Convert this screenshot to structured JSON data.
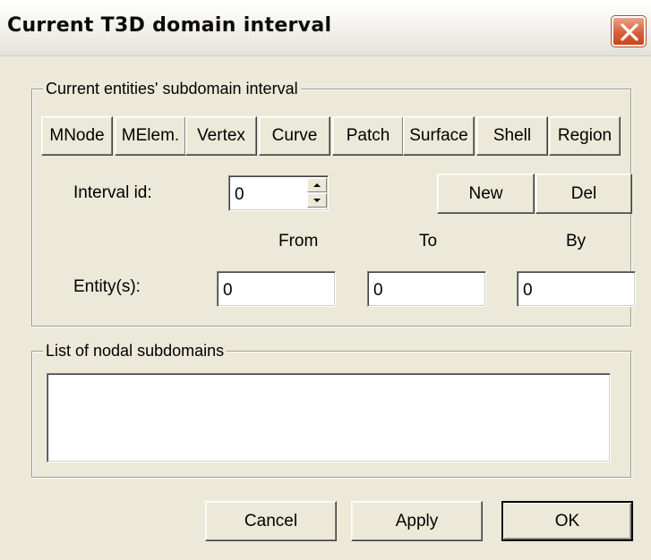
{
  "window": {
    "title": "Current T3D domain interval"
  },
  "subdomain_group": {
    "legend": "Current entities' subdomain interval",
    "entity_buttons": [
      {
        "label": "MNode"
      },
      {
        "label": "MElem."
      },
      {
        "label": "Vertex"
      },
      {
        "label": "Curve"
      },
      {
        "label": "Patch"
      },
      {
        "label": "Surface"
      },
      {
        "label": "Shell"
      },
      {
        "label": "Region"
      }
    ],
    "interval_id_label": "Interval id:",
    "interval_id_value": "0",
    "new_button": "New",
    "del_button": "Del",
    "from_header": "From",
    "to_header": "To",
    "by_header": "By",
    "entities_label": "Entity(s):",
    "from_value": "0",
    "to_value": "0",
    "by_value": "0"
  },
  "nodal_group": {
    "legend": "List of nodal subdomains"
  },
  "footer": {
    "cancel_label": "Cancel",
    "apply_label": "Apply",
    "ok_label": "OK"
  }
}
